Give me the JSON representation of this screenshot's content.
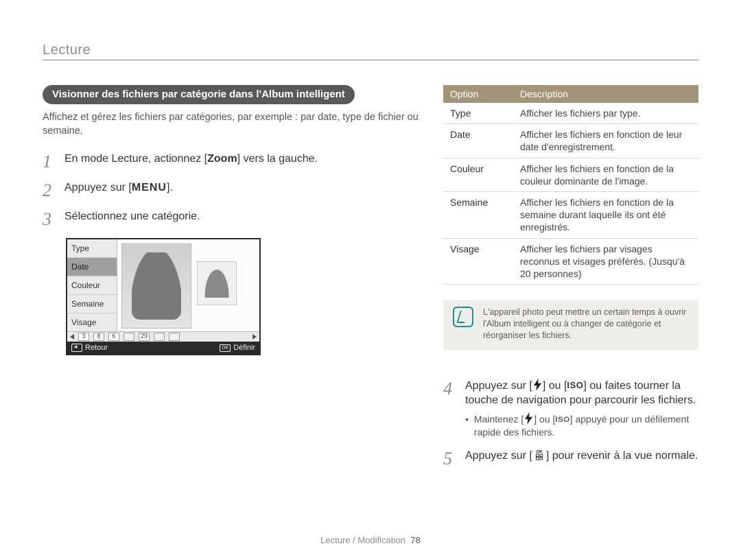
{
  "header": {
    "section": "Lecture"
  },
  "pill": "Visionner des fichiers par catégorie dans l'Album intelligent",
  "intro": "Affichez et gérez les fichiers par catégories, par exemple : par date, type de fichier ou semaine.",
  "steps": {
    "s1_a": "En mode Lecture, actionnez [",
    "s1_zoom": "Zoom",
    "s1_b": "] vers la gauche.",
    "s2_a": "Appuyez sur [",
    "s2_menu": "MENU",
    "s2_b": "].",
    "s3": "Sélectionnez une catégorie.",
    "s4_a": "Appuyez sur [",
    "s4_b": "] ou [",
    "s4_iso": "ISO",
    "s4_c": "] ou faites tourner la touche de navigation pour parcourir les fichiers.",
    "s4_sub_a": "Maintenez [",
    "s4_sub_b": "] ou [",
    "s4_sub_iso": "ISO",
    "s4_sub_c": "] appuyé pour un défilement rapide des fichiers.",
    "s5_a": "Appuyez sur [",
    "s5_b": "] pour revenir à la vue normale."
  },
  "screen": {
    "list": [
      "Type",
      "Date",
      "Couleur",
      "Semaine",
      "Visage"
    ],
    "selected_index": 1,
    "strip": [
      "3",
      "8",
      "6",
      "",
      "29",
      "",
      ""
    ],
    "footer_left": "Retour",
    "footer_right": "Définir"
  },
  "table": {
    "head": {
      "c1": "Option",
      "c2": "Description"
    },
    "rows": [
      {
        "opt": "Type",
        "desc": "Afficher les fichiers par type."
      },
      {
        "opt": "Date",
        "desc": "Afficher les fichiers en fonction de leur date d'enregistrement."
      },
      {
        "opt": "Couleur",
        "desc": "Afficher les fichiers en fonction de la couleur dominante de l'image."
      },
      {
        "opt": "Semaine",
        "desc": "Afficher les fichiers en fonction de la semaine durant laquelle ils ont été enregistrés."
      },
      {
        "opt": "Visage",
        "desc": "Afficher les fichiers par visages reconnus et visages préférés. (Jusqu'à 20 personnes)"
      }
    ]
  },
  "note": "L'appareil photo peut mettre un certain temps à ouvrir l'Album intelligent ou à changer de catégorie et réorganiser les fichiers.",
  "footer": {
    "crumb": "Lecture / Modification",
    "page": "78"
  }
}
